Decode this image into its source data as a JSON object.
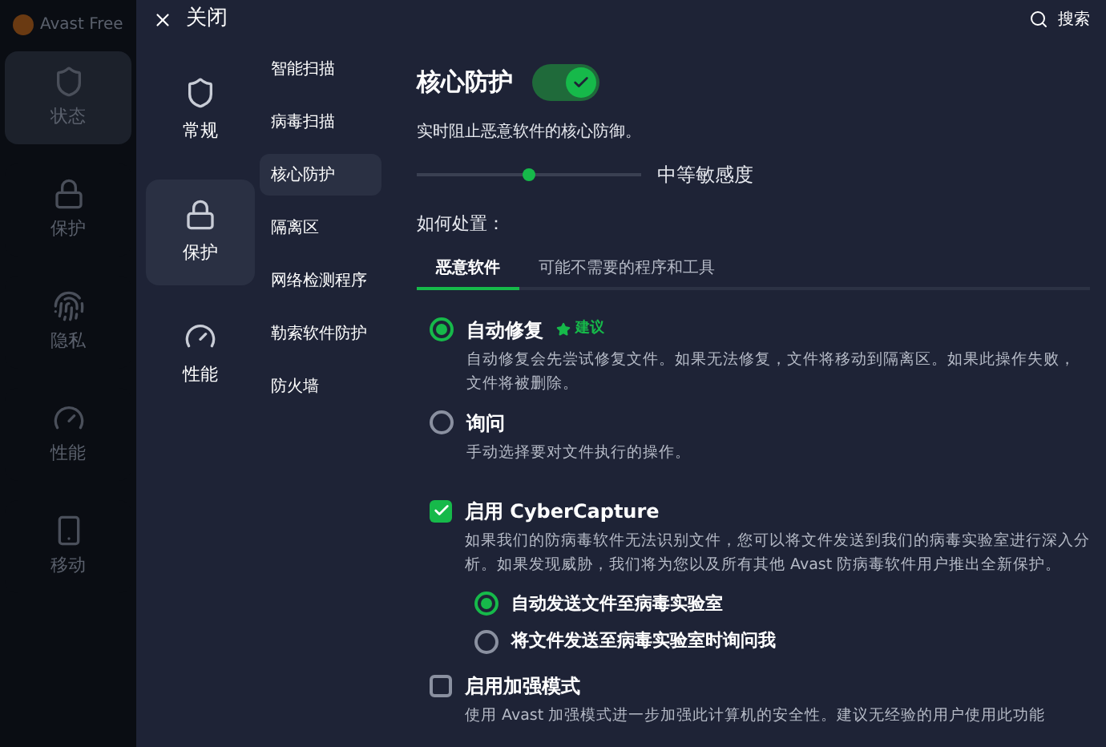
{
  "background_app": {
    "title": "Avast Free",
    "nav": [
      {
        "label": "状态",
        "selected": true
      },
      {
        "label": "保护",
        "selected": false
      },
      {
        "label": "隐私",
        "selected": false
      },
      {
        "label": "性能",
        "selected": false
      },
      {
        "label": "移动",
        "selected": false
      }
    ]
  },
  "header": {
    "close": "关闭",
    "search": "搜索"
  },
  "categories": [
    {
      "label": "常规",
      "selected": false
    },
    {
      "label": "保护",
      "selected": true
    },
    {
      "label": "性能",
      "selected": false
    }
  ],
  "subnav": [
    {
      "label": "智能扫描",
      "selected": false
    },
    {
      "label": "病毒扫描",
      "selected": false
    },
    {
      "label": "核心防护",
      "selected": true
    },
    {
      "label": "隔离区",
      "selected": false
    },
    {
      "label": "网络检测程序",
      "selected": false
    },
    {
      "label": "勒索软件防护",
      "selected": false
    },
    {
      "label": "防火墙",
      "selected": false
    }
  ],
  "content": {
    "title": "核心防护",
    "enabled": true,
    "description": "实时阻止恶意软件的核心防御。",
    "sensitivity": {
      "level": 0.5,
      "label": "中等敏感度"
    },
    "action_heading": "如何处置：",
    "tabs": [
      {
        "label": "恶意软件",
        "selected": true
      },
      {
        "label": "可能不需要的程序和工具",
        "selected": false
      }
    ],
    "actions": [
      {
        "label": "自动修复",
        "badge": "建议",
        "selected": true,
        "description": "自动修复会先尝试修复文件。如果无法修复，文件将移动到隔离区。如果此操作失败，文件将被删除。"
      },
      {
        "label": "询问",
        "selected": false,
        "description": "手动选择要对文件执行的操作。"
      }
    ],
    "options": [
      {
        "label": "启用 CyberCapture",
        "checked": true,
        "description": "如果我们的防病毒软件无法识别文件，您可以将文件发送到我们的病毒实验室进行深入分析。如果发现威胁，我们将为您以及所有其他 Avast 防病毒软件用户推出全新保护。",
        "choices": [
          {
            "label": "自动发送文件至病毒实验室",
            "selected": true
          },
          {
            "label": "将文件发送至病毒实验室时询问我",
            "selected": false
          }
        ]
      },
      {
        "label": "启用加强模式",
        "checked": false,
        "description": "使用 Avast 加强模式进一步加强此计算机的安全性。建议无经验的用户使用此功能"
      }
    ]
  }
}
